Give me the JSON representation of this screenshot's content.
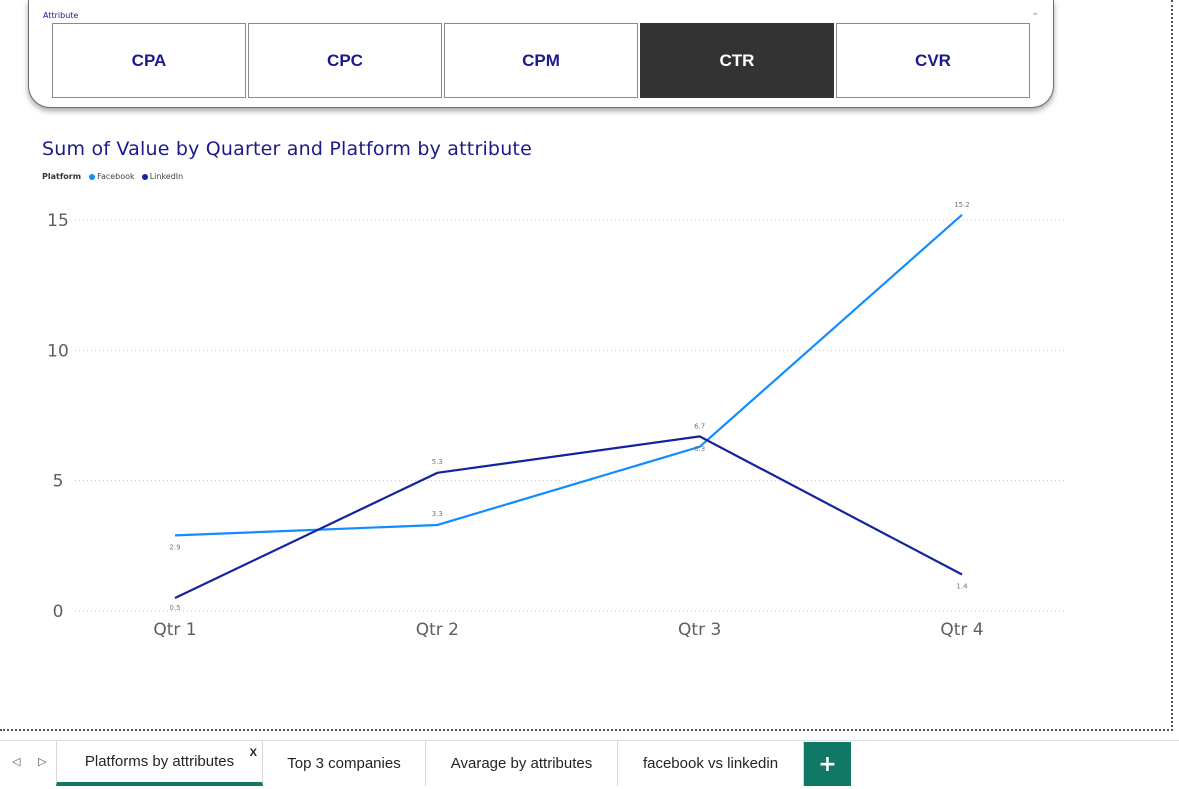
{
  "slicer": {
    "title": "Attribute",
    "chevron": "⌄",
    "options": [
      {
        "label": "CPA",
        "selected": false
      },
      {
        "label": "CPC",
        "selected": false
      },
      {
        "label": "CPM",
        "selected": false
      },
      {
        "label": "CTR",
        "selected": true
      },
      {
        "label": "CVR",
        "selected": false
      }
    ]
  },
  "chart_data": {
    "type": "line",
    "title": "Sum of Value by Quarter and Platform by attribute",
    "legend_title": "Platform",
    "legend_position": "top-left",
    "categories": [
      "Qtr 1",
      "Qtr 2",
      "Qtr 3",
      "Qtr 4"
    ],
    "series": [
      {
        "name": "Facebook",
        "color": "#118DFF",
        "values": [
          2.9,
          3.3,
          6.3,
          15.2
        ],
        "labels": [
          "2.9",
          "3.3",
          "6.3",
          "15.2"
        ]
      },
      {
        "name": "LinkedIn",
        "color": "#12239E",
        "values": [
          0.5,
          5.3,
          6.7,
          1.4
        ],
        "labels": [
          "0.5",
          "5.3",
          "6.7",
          "1.4"
        ]
      }
    ],
    "ylim": [
      0,
      15
    ],
    "yticks": [
      "0",
      "5",
      "10",
      "15"
    ],
    "grid": true
  },
  "tabs": {
    "prev_arrow": "◁",
    "next_arrow": "▷",
    "items": [
      {
        "label": "Platforms by attributes",
        "active": true,
        "close": "X"
      },
      {
        "label": "Top 3 companies",
        "active": false
      },
      {
        "label": "Avarage by attributes",
        "active": false
      },
      {
        "label": "facebook vs linkedin",
        "active": false
      }
    ],
    "add_label": "+"
  }
}
